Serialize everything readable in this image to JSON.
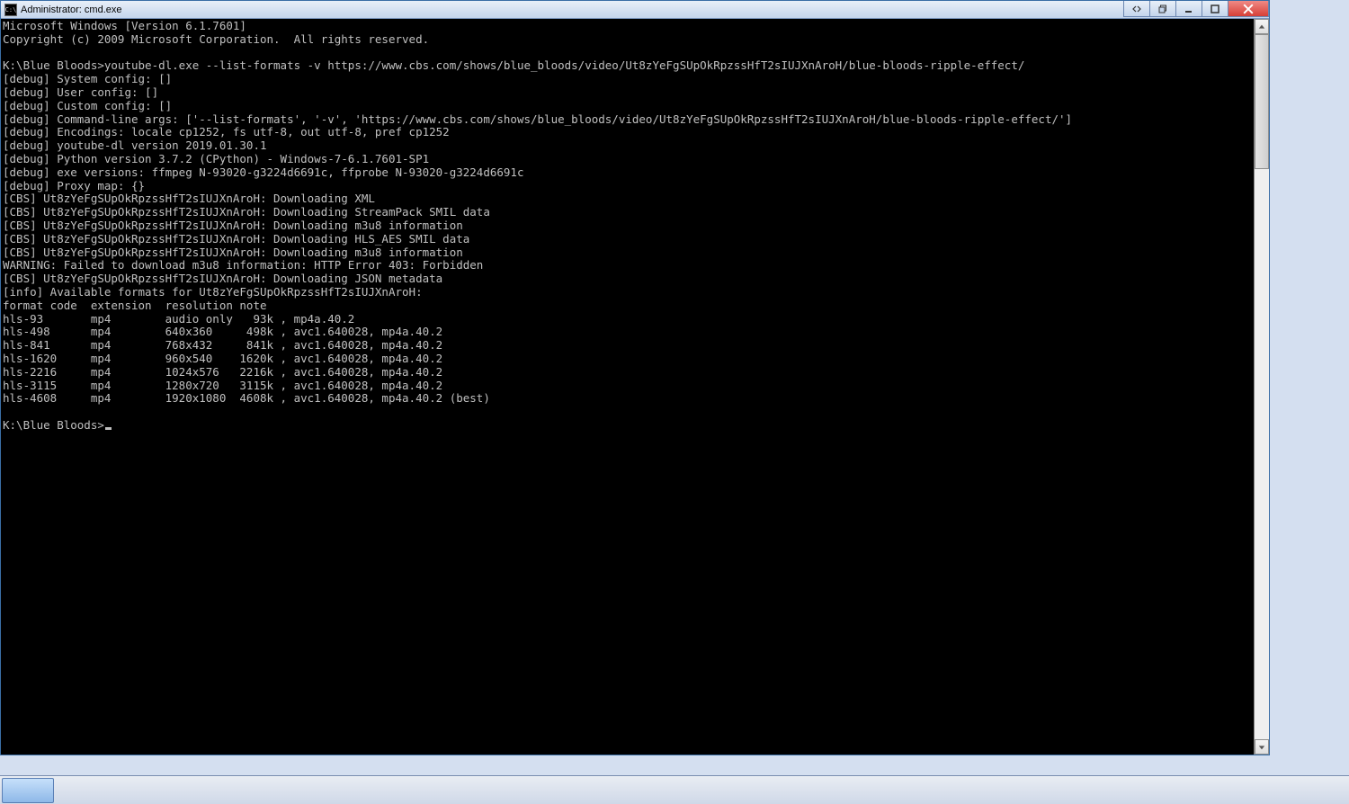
{
  "window": {
    "title": "Administrator: cmd.exe"
  },
  "header": {
    "line1": "Microsoft Windows [Version 6.1.7601]",
    "line2": "Copyright (c) 2009 Microsoft Corporation.  All rights reserved."
  },
  "prompt1": "K:\\Blue Bloods>",
  "command": "youtube-dl.exe --list-formats -v https://www.cbs.com/shows/blue_bloods/video/Ut8zYeFgSUpOkRpzssHfT2sIUJXnAroH/blue-bloods-ripple-effect/",
  "debug_lines": [
    "[debug] System config: []",
    "[debug] User config: []",
    "[debug] Custom config: []",
    "[debug] Command-line args: ['--list-formats', '-v', 'https://www.cbs.com/shows/blue_bloods/video/Ut8zYeFgSUpOkRpzssHfT2sIUJXnAroH/blue-bloods-ripple-effect/']",
    "[debug] Encodings: locale cp1252, fs utf-8, out utf-8, pref cp1252",
    "[debug] youtube-dl version 2019.01.30.1",
    "[debug] Python version 3.7.2 (CPython) - Windows-7-6.1.7601-SP1",
    "[debug] exe versions: ffmpeg N-93020-g3224d6691c, ffprobe N-93020-g3224d6691c",
    "[debug] Proxy map: {}",
    "[CBS] Ut8zYeFgSUpOkRpzssHfT2sIUJXnAroH: Downloading XML",
    "[CBS] Ut8zYeFgSUpOkRpzssHfT2sIUJXnAroH: Downloading StreamPack SMIL data",
    "[CBS] Ut8zYeFgSUpOkRpzssHfT2sIUJXnAroH: Downloading m3u8 information",
    "[CBS] Ut8zYeFgSUpOkRpzssHfT2sIUJXnAroH: Downloading HLS_AES SMIL data",
    "[CBS] Ut8zYeFgSUpOkRpzssHfT2sIUJXnAroH: Downloading m3u8 information",
    "WARNING: Failed to download m3u8 information: HTTP Error 403: Forbidden",
    "[CBS] Ut8zYeFgSUpOkRpzssHfT2sIUJXnAroH: Downloading JSON metadata",
    "[info] Available formats for Ut8zYeFgSUpOkRpzssHfT2sIUJXnAroH:"
  ],
  "table": {
    "header": {
      "c0": "format code",
      "c1": "extension",
      "c2": "resolution",
      "c3": "note"
    },
    "rows": [
      {
        "c0": "hls-93",
        "c1": "mp4",
        "c2": "audio only",
        "c3": "  93k , mp4a.40.2"
      },
      {
        "c0": "hls-498",
        "c1": "mp4",
        "c2": "640x360   ",
        "c3": " 498k , avc1.640028, mp4a.40.2"
      },
      {
        "c0": "hls-841",
        "c1": "mp4",
        "c2": "768x432   ",
        "c3": " 841k , avc1.640028, mp4a.40.2"
      },
      {
        "c0": "hls-1620",
        "c1": "mp4",
        "c2": "960x540   ",
        "c3": "1620k , avc1.640028, mp4a.40.2"
      },
      {
        "c0": "hls-2216",
        "c1": "mp4",
        "c2": "1024x576  ",
        "c3": "2216k , avc1.640028, mp4a.40.2"
      },
      {
        "c0": "hls-3115",
        "c1": "mp4",
        "c2": "1280x720  ",
        "c3": "3115k , avc1.640028, mp4a.40.2"
      },
      {
        "c0": "hls-4608",
        "c1": "mp4",
        "c2": "1920x1080 ",
        "c3": "4608k , avc1.640028, mp4a.40.2 (best)"
      }
    ]
  },
  "prompt2": "K:\\Blue Bloods>"
}
